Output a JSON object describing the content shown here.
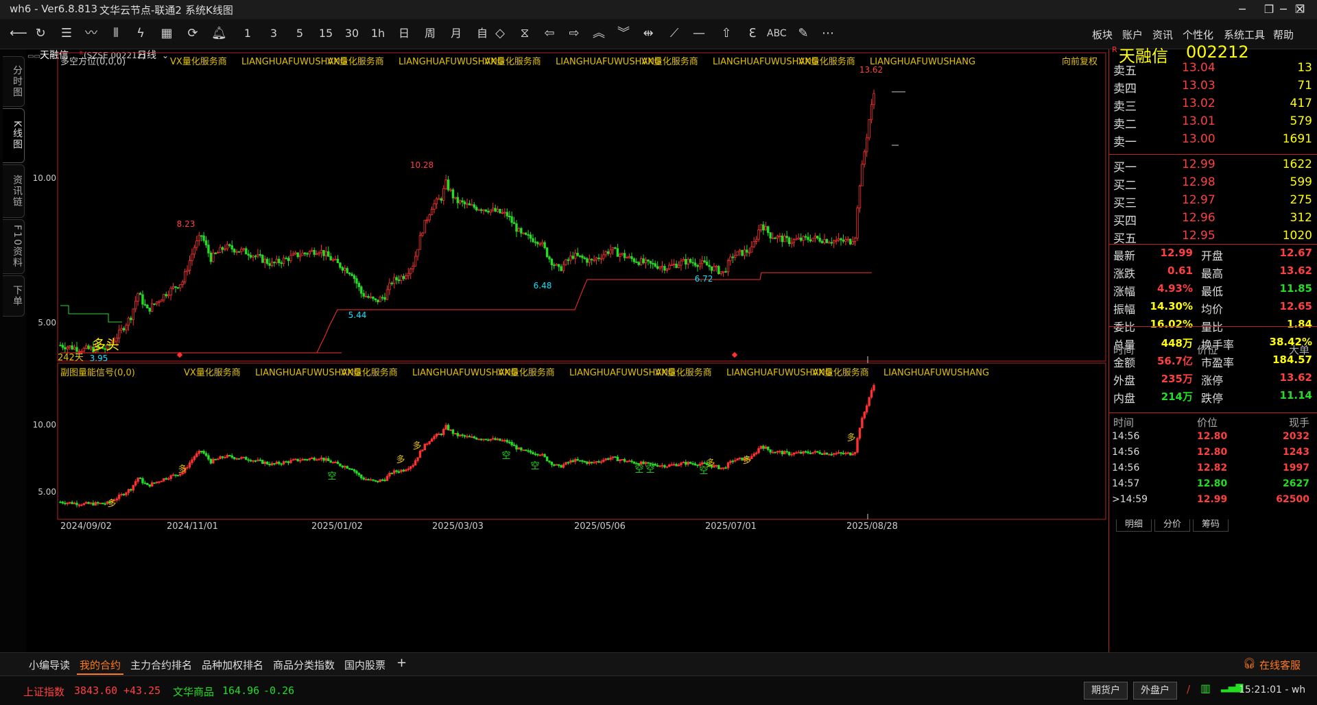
{
  "titlebar": {
    "app": "wh6  -  Ver6.8.813",
    "server": "文华云节点-联通2",
    "view": "系统K线图"
  },
  "toolbar": {
    "periods": [
      "1",
      "3",
      "5",
      "15",
      "30",
      "1h",
      "日",
      "周",
      "月",
      "自"
    ],
    "right_menu": [
      "板块",
      "账户",
      "资讯",
      "个性化",
      "系统工具",
      "帮助"
    ],
    "text_tool": "ABC"
  },
  "left_tabs": [
    "分时图",
    "K线图",
    "资讯链",
    "F10资料",
    "下单"
  ],
  "header": {
    "name": "天融信",
    "code": "(SZSE 002212)",
    "period": "日线"
  },
  "main": {
    "indicator": "多空方位(0,0,0)",
    "ads": [
      "VX量化服务商",
      "LIANGHUAFUWUSHANG",
      "VX量化服务商",
      "LIANGHUAFUWUSHANG",
      "VX量化服务商",
      "LIANGHUAFUWUSHANG",
      "VX量化服务商",
      "LIANGHUAFUWUSHANG",
      "VX量化服务商",
      "LIANGHUAFUWUSHANG"
    ],
    "adjust": "向前复权",
    "y_labels": [
      "10.00",
      "5.00"
    ],
    "days": "242天",
    "trend_label": "多头",
    "annotations": [
      "13.62",
      "10.28",
      "8.23",
      "6.48",
      "6.72",
      "5.44",
      "3.95"
    ]
  },
  "sub": {
    "indicator": "副图量能信号(0,0)",
    "ads": [
      "VX量化服务商",
      "LIANGHUAFUWUSHANG",
      "VX量化服务商",
      "LIANGHUAFUWUSHANG",
      "VX量化服务商",
      "LIANGHUAFUWUSHANG",
      "VX量化服务商",
      "LIANGHUAFUWUSHANG",
      "VX量化服务商",
      "LIANGHUAFUWUSHANG"
    ],
    "y_labels": [
      "10.00",
      "5.00"
    ],
    "signals": [
      "多",
      "多",
      "空",
      "多",
      "多",
      "空",
      "空",
      "空",
      "空",
      "空",
      "多",
      "多",
      "多"
    ]
  },
  "x_dates": [
    "2024/09/02",
    "2024/11/01",
    "2025/01/02",
    "2025/03/03",
    "2025/05/06",
    "2025/07/01",
    "2025/08/28"
  ],
  "quote": {
    "badge": "R",
    "name": "天融信",
    "code": "002212",
    "asks": [
      {
        "label": "卖五",
        "price": "13.04",
        "vol": "13"
      },
      {
        "label": "卖四",
        "price": "13.03",
        "vol": "71"
      },
      {
        "label": "卖三",
        "price": "13.02",
        "vol": "417"
      },
      {
        "label": "卖二",
        "price": "13.01",
        "vol": "579"
      },
      {
        "label": "卖一",
        "price": "13.00",
        "vol": "1691"
      }
    ],
    "bids": [
      {
        "label": "买一",
        "price": "12.99",
        "vol": "1622"
      },
      {
        "label": "买二",
        "price": "12.98",
        "vol": "599"
      },
      {
        "label": "买三",
        "price": "12.97",
        "vol": "275"
      },
      {
        "label": "买四",
        "price": "12.96",
        "vol": "312"
      },
      {
        "label": "买五",
        "price": "12.95",
        "vol": "1020"
      }
    ],
    "stats": [
      {
        "l1": "最新",
        "v1": "12.99",
        "c1": "#ff4040",
        "l2": "开盘",
        "v2": "12.67",
        "c2": "#ff4040"
      },
      {
        "l1": "涨跌",
        "v1": "0.61",
        "c1": "#ff4040",
        "l2": "最高",
        "v2": "13.62",
        "c2": "#ff4040"
      },
      {
        "l1": "涨幅",
        "v1": "4.93%",
        "c1": "#ff4040",
        "l2": "最低",
        "v2": "11.85",
        "c2": "#22dd22"
      },
      {
        "l1": "振幅",
        "v1": "14.30%",
        "c1": "#ffff00",
        "l2": "均价",
        "v2": "12.65",
        "c2": "#ff4040"
      },
      {
        "l1": "委比",
        "v1": "16.02%",
        "c1": "#ffff00",
        "l2": "量比",
        "v2": "1.84",
        "c2": "#ffff00"
      },
      {
        "l1": "总量",
        "v1": "448万",
        "c1": "#ffff00",
        "l2": "换手率",
        "v2": "38.42%",
        "c2": "#ffff00"
      },
      {
        "l1": "金额",
        "v1": "56.7亿",
        "c1": "#ff4040",
        "l2": "市盈率",
        "v2": "184.57",
        "c2": "#ffff00"
      },
      {
        "l1": "外盘",
        "v1": "235万",
        "c1": "#ff4040",
        "l2": "涨停",
        "v2": "13.62",
        "c2": "#ff4040"
      },
      {
        "l1": "内盘",
        "v1": "214万",
        "c1": "#22dd22",
        "l2": "跌停",
        "v2": "11.14",
        "c2": "#22dd22"
      }
    ],
    "tick_header": [
      "时间",
      "价位",
      "大单"
    ],
    "trade_header": [
      "时间",
      "价位",
      "现手"
    ],
    "trades": [
      {
        "time": "14:56",
        "price": "12.80",
        "vol": "2032",
        "c": "#ff4040"
      },
      {
        "time": "14:56",
        "price": "12.80",
        "vol": "1243",
        "c": "#ff4040"
      },
      {
        "time": "14:56",
        "price": "12.82",
        "vol": "1997",
        "c": "#ff4040"
      },
      {
        "time": "14:57",
        "price": "12.80",
        "vol": "2627",
        "c": "#22dd22"
      },
      {
        "time": ">14:59",
        "price": "12.99",
        "vol": "62500",
        "c": "#ff4040"
      }
    ],
    "tabs": [
      "明细",
      "分价",
      "筹码"
    ]
  },
  "bottom_tabs": [
    "小编导读",
    "我的合约",
    "主力合约排名",
    "品种加权排名",
    "商品分类指数",
    "国内股票"
  ],
  "service": "在线客服",
  "status": {
    "idx1_name": "上证指数",
    "idx1_val": "3843.60",
    "idx1_chg": "+43.25",
    "idx2_name": "文华商品",
    "idx2_val": "164.96",
    "idx2_chg": "-0.26",
    "btn1": "期货户",
    "btn2": "外盘户",
    "time": "15:21:01 - wh"
  },
  "colors": {
    "up": "#ff3030",
    "down": "#22dd22",
    "ad": "#e0c000",
    "frame": "#b22222"
  }
}
